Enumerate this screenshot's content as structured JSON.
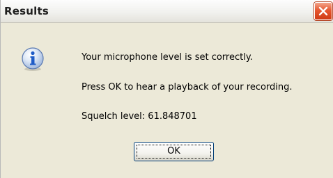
{
  "window": {
    "title": "Results"
  },
  "icons": {
    "message_icon": "information-icon",
    "close_icon": "close-icon"
  },
  "message": {
    "line1": "Your microphone level is set correctly.",
    "line2": "Press OK to hear a playback of your recording.",
    "line3": "Squelch level: 61.848701"
  },
  "buttons": {
    "ok_label": "OK"
  },
  "colors": {
    "dialog_background": "#ece9d8",
    "close_button": "#e6562f",
    "info_icon": "#1f5cc7"
  }
}
